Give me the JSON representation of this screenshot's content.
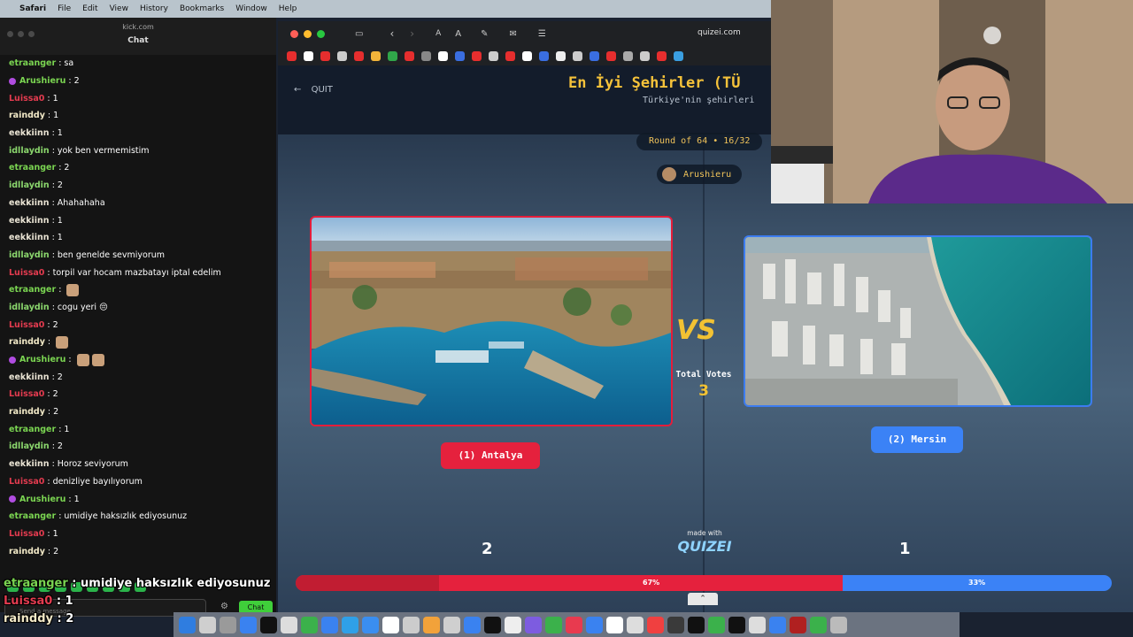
{
  "menubar": {
    "app": "Safari",
    "items": [
      "File",
      "Edit",
      "View",
      "History",
      "Bookmarks",
      "Window",
      "Help"
    ]
  },
  "chat_window": {
    "url": "kick.com",
    "title": "Chat",
    "messages": [
      {
        "user": "etraanger",
        "text": "sa",
        "color": "#7ad451",
        "badge": false,
        "emotes": 0
      },
      {
        "user": "Arushieru",
        "text": "2",
        "color": "#7ad451",
        "badge": true,
        "emotes": 0
      },
      {
        "user": "Luissa0",
        "text": "1",
        "color": "#e33b4f",
        "badge": false,
        "emotes": 0
      },
      {
        "user": "rainddy",
        "text": "1",
        "color": "#f2e9c7",
        "badge": false,
        "emotes": 0
      },
      {
        "user": "eekkiinn",
        "text": "1",
        "color": "#e9e3d3",
        "badge": false,
        "emotes": 0
      },
      {
        "user": "idllaydin",
        "text": "yok ben vermemistim",
        "color": "#8bd76d",
        "badge": false,
        "emotes": 0
      },
      {
        "user": "etraanger",
        "text": "2",
        "color": "#7ad451",
        "badge": false,
        "emotes": 0
      },
      {
        "user": "idllaydin",
        "text": "2",
        "color": "#8bd76d",
        "badge": false,
        "emotes": 0
      },
      {
        "user": "eekkiinn",
        "text": "Ahahahaha",
        "color": "#e9e3d3",
        "badge": false,
        "emotes": 0
      },
      {
        "user": "eekkiinn",
        "text": "1",
        "color": "#e9e3d3",
        "badge": false,
        "emotes": 0
      },
      {
        "user": "eekkiinn",
        "text": "1",
        "color": "#e9e3d3",
        "badge": false,
        "emotes": 0
      },
      {
        "user": "idllaydin",
        "text": "ben genelde sevmiyorum",
        "color": "#8bd76d",
        "badge": false,
        "emotes": 0
      },
      {
        "user": "Luissa0",
        "text": "torpil var hocam mazbatayı iptal edelim",
        "color": "#e33b4f",
        "badge": false,
        "emotes": 0
      },
      {
        "user": "etraanger",
        "text": "",
        "color": "#7ad451",
        "badge": false,
        "emotes": 1
      },
      {
        "user": "idllaydin",
        "text": "cogu yeri 😔",
        "color": "#8bd76d",
        "badge": false,
        "emotes": 0
      },
      {
        "user": "Luissa0",
        "text": "2",
        "color": "#e33b4f",
        "badge": false,
        "emotes": 0
      },
      {
        "user": "rainddy",
        "text": "",
        "color": "#f2e9c7",
        "badge": false,
        "emotes": 1
      },
      {
        "user": "Arushieru",
        "text": "",
        "color": "#7ad451",
        "badge": true,
        "emotes": 2
      },
      {
        "user": "eekkiinn",
        "text": "2",
        "color": "#e9e3d3",
        "badge": false,
        "emotes": 0
      },
      {
        "user": "Luissa0",
        "text": "2",
        "color": "#e33b4f",
        "badge": false,
        "emotes": 0
      },
      {
        "user": "rainddy",
        "text": "2",
        "color": "#f2e9c7",
        "badge": false,
        "emotes": 0
      },
      {
        "user": "etraanger",
        "text": "1",
        "color": "#7ad451",
        "badge": false,
        "emotes": 0
      },
      {
        "user": "idllaydin",
        "text": "2",
        "color": "#8bd76d",
        "badge": false,
        "emotes": 0
      },
      {
        "user": "eekkiinn",
        "text": "Horoz seviyorum",
        "color": "#e9e3d3",
        "badge": false,
        "emotes": 0
      },
      {
        "user": "Luissa0",
        "text": "denizliye bayılıyorum",
        "color": "#e33b4f",
        "badge": false,
        "emotes": 0
      },
      {
        "user": "Arushieru",
        "text": "1",
        "color": "#7ad451",
        "badge": true,
        "emotes": 0
      },
      {
        "user": "etraanger",
        "text": "umidiye haksızlık ediyosunuz",
        "color": "#7ad451",
        "badge": false,
        "emotes": 0
      },
      {
        "user": "Luissa0",
        "text": "1",
        "color": "#e33b4f",
        "badge": false,
        "emotes": 0
      },
      {
        "user": "rainddy",
        "text": "2",
        "color": "#f2e9c7",
        "badge": false,
        "emotes": 0
      }
    ],
    "input_placeholder": "Send a message",
    "send_label": "Chat"
  },
  "overlay_chat": [
    {
      "user": "etraanger",
      "text": " : umidiye haksızlık ediyosunuz",
      "color": "#7ad451"
    },
    {
      "user": "Luissa0",
      "text": " : 1",
      "color": "#e33b4f"
    },
    {
      "user": "rainddy",
      "text": " : 2",
      "color": "#f2e9c7"
    }
  ],
  "browser": {
    "address": "quizei.com"
  },
  "quiz": {
    "quit_label": "QUIT",
    "title": "En İyi Şehirler (TÜ",
    "subtitle": "Türkiye'nin şehirleri",
    "round": "Round of 64 • 16/32",
    "voter": "Arushieru",
    "total_votes_label": "Total Votes",
    "total_votes": "3",
    "vs": "VS",
    "left": {
      "label": "(1) Antalya",
      "votes": "2",
      "percent_text": "67%",
      "share": 0.67
    },
    "right": {
      "label": "(2) Mersin",
      "votes": "1",
      "percent_text": "33%",
      "share": 0.33
    },
    "made_with": "made with",
    "brand": "QUIZEI",
    "colors": {
      "accent": "#f2c233",
      "left": "#e5213d",
      "right": "#3b82f6"
    }
  }
}
